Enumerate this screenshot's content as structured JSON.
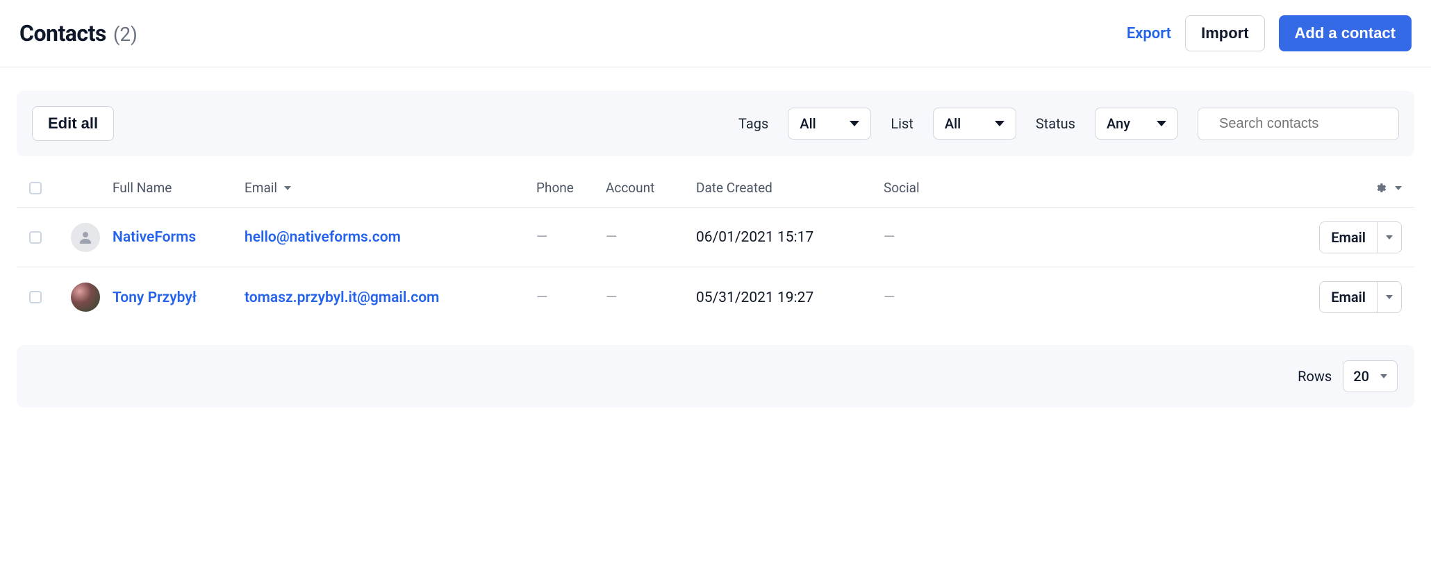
{
  "header": {
    "title": "Contacts",
    "count_display": "(2)",
    "export_label": "Export",
    "import_label": "Import",
    "add_label": "Add a contact"
  },
  "filters": {
    "edit_all_label": "Edit all",
    "tags_label": "Tags",
    "tags_value": "All",
    "list_label": "List",
    "list_value": "All",
    "status_label": "Status",
    "status_value": "Any",
    "search_placeholder": "Search contacts"
  },
  "columns": {
    "full_name": "Full Name",
    "email": "Email",
    "phone": "Phone",
    "account": "Account",
    "date_created": "Date Created",
    "social": "Social"
  },
  "rows": [
    {
      "name": "NativeForms",
      "email": "hello@nativeforms.com",
      "phone": "—",
      "account": "—",
      "date": "06/01/2021 15:17",
      "social": "—",
      "action_label": "Email",
      "avatar_kind": "placeholder"
    },
    {
      "name": "Tony Przybył",
      "email": "tomasz.przybyl.it@gmail.com",
      "phone": "—",
      "account": "—",
      "date": "05/31/2021 19:27",
      "social": "—",
      "action_label": "Email",
      "avatar_kind": "photo"
    }
  ],
  "footer": {
    "rows_label": "Rows",
    "rows_value": "20"
  }
}
